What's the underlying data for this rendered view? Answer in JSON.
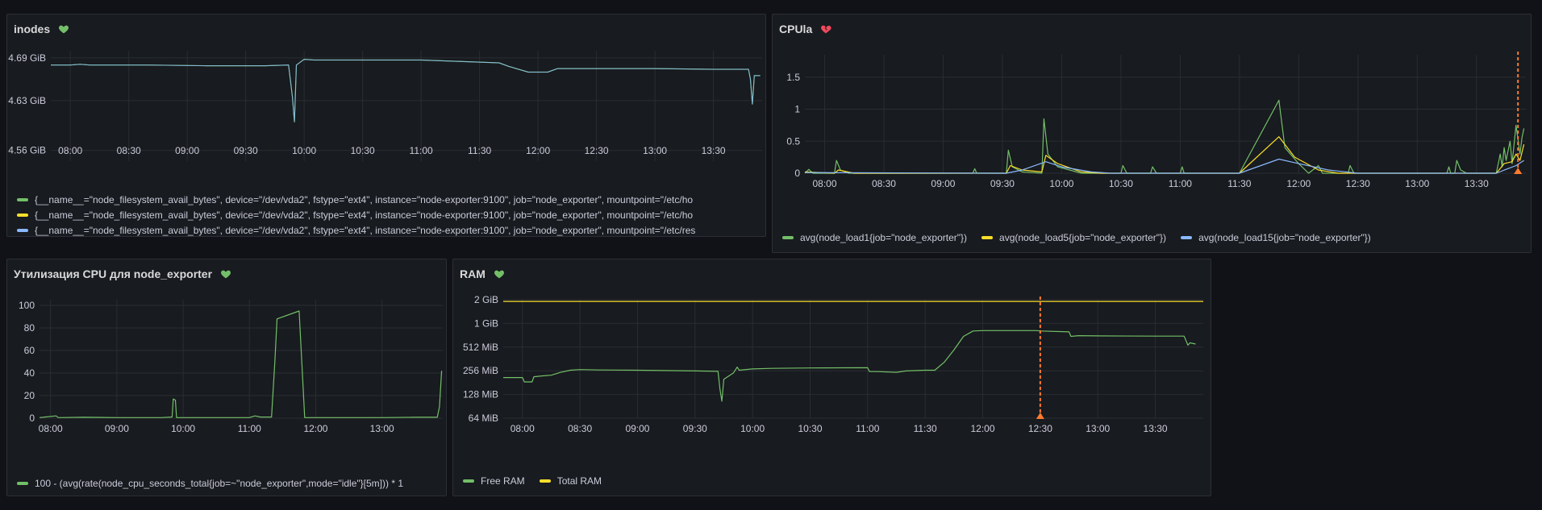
{
  "panels": {
    "inodes": {
      "title": "inodes",
      "heart_color": "#73bf69",
      "legend": [
        {
          "label": "{__name__=\"node_filesystem_avail_bytes\", device=\"/dev/vda2\", fstype=\"ext4\", instance=\"node-exporter:9100\", job=\"node_exporter\", mountpoint=\"/etc/ho",
          "color": "#73bf69"
        },
        {
          "label": "{__name__=\"node_filesystem_avail_bytes\", device=\"/dev/vda2\", fstype=\"ext4\", instance=\"node-exporter:9100\", job=\"node_exporter\", mountpoint=\"/etc/ho",
          "color": "#fade2a"
        },
        {
          "label": "{__name__=\"node_filesystem_avail_bytes\", device=\"/dev/vda2\", fstype=\"ext4\", instance=\"node-exporter:9100\", job=\"node_exporter\", mountpoint=\"/etc/res",
          "color": "#8ab8ff"
        }
      ]
    },
    "cpula": {
      "title": "CPUla",
      "heart_color": "#f2495c",
      "legend": [
        {
          "label": "avg(node_load1{job=\"node_exporter\"})",
          "color": "#73bf69"
        },
        {
          "label": "avg(node_load5{job=\"node_exporter\"})",
          "color": "#fade2a"
        },
        {
          "label": "avg(node_load15{job=\"node_exporter\"})",
          "color": "#8ab8ff"
        }
      ]
    },
    "cpu_util": {
      "title": "Утилизация CPU для node_exporter",
      "heart_color": "#73bf69",
      "legend": [
        {
          "label": "100 - (avg(rate(node_cpu_seconds_total{job=~\"node_exporter\",mode=\"idle\"}[5m])) * 1",
          "color": "#73bf69"
        }
      ]
    },
    "ram": {
      "title": "RAM",
      "heart_color": "#73bf69",
      "legend": [
        {
          "label": "Free RAM",
          "color": "#73bf69"
        },
        {
          "label": "Total RAM",
          "color": "#fade2a"
        }
      ]
    }
  },
  "colors": {
    "grid": "#2a2d33",
    "annotation": "#ff7a2f"
  },
  "chart_data": [
    {
      "id": "inodes",
      "type": "line",
      "title": "inodes",
      "x_ticks": [
        "08:00",
        "08:30",
        "09:00",
        "09:30",
        "10:00",
        "10:30",
        "11:00",
        "11:30",
        "12:00",
        "12:30",
        "13:00",
        "13:30"
      ],
      "y_ticks": [
        "4.69 GiB",
        "4.63 GiB",
        "4.56 GiB"
      ],
      "y_tick_values": [
        4.69,
        4.63,
        4.56
      ],
      "xlim": [
        "07:50",
        "13:55"
      ],
      "ylim": [
        4.545,
        4.7
      ],
      "series": [
        {
          "points": [
            [
              "07:50",
              4.68
            ],
            [
              "08:00",
              4.68
            ],
            [
              "08:05",
              4.681
            ],
            [
              "08:10",
              4.68
            ],
            [
              "08:40",
              4.68
            ],
            [
              "09:10",
              4.679
            ],
            [
              "09:40",
              4.679
            ],
            [
              "09:52",
              4.68
            ],
            [
              "09:54",
              4.635
            ],
            [
              "09:55",
              4.6
            ],
            [
              "09:56",
              4.68
            ],
            [
              "10:00",
              4.688
            ],
            [
              "10:05",
              4.687
            ],
            [
              "10:30",
              4.687
            ],
            [
              "11:00",
              4.687
            ],
            [
              "11:40",
              4.683
            ],
            [
              "11:45",
              4.678
            ],
            [
              "11:55",
              4.67
            ],
            [
              "12:05",
              4.67
            ],
            [
              "12:10",
              4.675
            ],
            [
              "12:30",
              4.675
            ],
            [
              "13:00",
              4.675
            ],
            [
              "13:30",
              4.674
            ],
            [
              "13:48",
              4.674
            ],
            [
              "13:49",
              4.66
            ],
            [
              "13:50",
              4.625
            ],
            [
              "13:51",
              4.665
            ],
            [
              "13:54",
              4.665
            ]
          ]
        }
      ]
    },
    {
      "id": "cpula",
      "type": "line",
      "title": "CPUla",
      "x_ticks": [
        "08:00",
        "08:30",
        "09:00",
        "09:30",
        "10:00",
        "10:30",
        "11:00",
        "11:30",
        "12:00",
        "12:30",
        "13:00",
        "13:30"
      ],
      "y_ticks": [
        "1.5",
        "1",
        "0.5",
        "0"
      ],
      "y_tick_values": [
        1.5,
        1,
        0.5,
        0
      ],
      "xlim": [
        "07:50",
        "13:55"
      ],
      "ylim": [
        0,
        1.85
      ],
      "annotations": [
        {
          "x": "13:51"
        }
      ],
      "series": [
        {
          "color_index": 0,
          "points": [
            [
              "07:50",
              0
            ],
            [
              "07:52",
              0.06
            ],
            [
              "07:54",
              0
            ],
            [
              "08:05",
              0
            ],
            [
              "08:06",
              0.2
            ],
            [
              "08:08",
              0.05
            ],
            [
              "08:12",
              0
            ],
            [
              "09:15",
              0
            ],
            [
              "09:16",
              0.07
            ],
            [
              "09:17",
              0
            ],
            [
              "09:32",
              0
            ],
            [
              "09:33",
              0.36
            ],
            [
              "09:35",
              0.1
            ],
            [
              "09:40",
              0.02
            ],
            [
              "09:50",
              0
            ],
            [
              "09:51",
              0.85
            ],
            [
              "09:53",
              0.3
            ],
            [
              "09:58",
              0.1
            ],
            [
              "10:10",
              0
            ],
            [
              "10:30",
              0
            ],
            [
              "10:31",
              0.12
            ],
            [
              "10:33",
              0
            ],
            [
              "10:45",
              0
            ],
            [
              "10:46",
              0.1
            ],
            [
              "10:48",
              0
            ],
            [
              "11:00",
              0
            ],
            [
              "11:01",
              0.1
            ],
            [
              "11:02",
              0
            ],
            [
              "11:30",
              0
            ],
            [
              "11:50",
              1.14
            ],
            [
              "11:53",
              0.4
            ],
            [
              "12:00",
              0.15
            ],
            [
              "12:05",
              0
            ],
            [
              "12:10",
              0.12
            ],
            [
              "12:12",
              0
            ],
            [
              "12:25",
              0
            ],
            [
              "12:26",
              0.12
            ],
            [
              "12:28",
              0
            ],
            [
              "13:15",
              0
            ],
            [
              "13:16",
              0.1
            ],
            [
              "13:17",
              0
            ],
            [
              "13:19",
              0
            ],
            [
              "13:20",
              0.2
            ],
            [
              "13:22",
              0.05
            ],
            [
              "13:25",
              0
            ],
            [
              "13:40",
              0
            ],
            [
              "13:42",
              0.3
            ],
            [
              "13:43",
              0.1
            ],
            [
              "13:44",
              0.4
            ],
            [
              "13:45",
              0.2
            ],
            [
              "13:47",
              0.5
            ],
            [
              "13:48",
              0.15
            ],
            [
              "13:50",
              0.75
            ],
            [
              "13:52",
              0.3
            ],
            [
              "13:53",
              0.55
            ],
            [
              "13:54",
              0.7
            ]
          ]
        },
        {
          "color_index": 1,
          "points": [
            [
              "07:50",
              0.02
            ],
            [
              "08:05",
              0
            ],
            [
              "08:07",
              0.05
            ],
            [
              "08:15",
              0
            ],
            [
              "09:32",
              0
            ],
            [
              "09:34",
              0.12
            ],
            [
              "09:40",
              0.05
            ],
            [
              "09:50",
              0.02
            ],
            [
              "09:52",
              0.28
            ],
            [
              "09:58",
              0.15
            ],
            [
              "10:10",
              0.02
            ],
            [
              "10:20",
              0
            ],
            [
              "11:30",
              0
            ],
            [
              "11:50",
              0.57
            ],
            [
              "11:58",
              0.25
            ],
            [
              "12:10",
              0.05
            ],
            [
              "12:20",
              0
            ],
            [
              "13:40",
              0
            ],
            [
              "13:44",
              0.15
            ],
            [
              "13:48",
              0.18
            ],
            [
              "13:50",
              0.3
            ],
            [
              "13:52",
              0.2
            ],
            [
              "13:54",
              0.45
            ]
          ]
        },
        {
          "color_index": 2,
          "points": [
            [
              "07:50",
              0.01
            ],
            [
              "09:32",
              0
            ],
            [
              "09:40",
              0.05
            ],
            [
              "09:52",
              0.18
            ],
            [
              "10:00",
              0.1
            ],
            [
              "10:15",
              0.02
            ],
            [
              "10:25",
              0
            ],
            [
              "11:30",
              0
            ],
            [
              "11:50",
              0.22
            ],
            [
              "12:00",
              0.15
            ],
            [
              "12:15",
              0.05
            ],
            [
              "12:30",
              0
            ],
            [
              "13:40",
              0
            ],
            [
              "13:45",
              0.06
            ],
            [
              "13:50",
              0.12
            ],
            [
              "13:54",
              0.2
            ]
          ]
        }
      ]
    },
    {
      "id": "cpu_util",
      "type": "line",
      "title": "Утилизация CPU для node_exporter",
      "x_ticks": [
        "08:00",
        "09:00",
        "10:00",
        "11:00",
        "12:00",
        "13:00"
      ],
      "y_ticks": [
        "100",
        "80",
        "60",
        "40",
        "20",
        "0"
      ],
      "y_tick_values": [
        100,
        80,
        60,
        40,
        20,
        0
      ],
      "xlim": [
        "07:50",
        "13:55"
      ],
      "ylim": [
        0,
        105
      ],
      "series": [
        {
          "points": [
            [
              "07:50",
              0.5
            ],
            [
              "07:55",
              1
            ],
            [
              "08:05",
              2
            ],
            [
              "08:07",
              0.5
            ],
            [
              "08:30",
              0.8
            ],
            [
              "09:00",
              0.5
            ],
            [
              "09:40",
              0.5
            ],
            [
              "09:50",
              1
            ],
            [
              "09:51",
              17
            ],
            [
              "09:53",
              16
            ],
            [
              "09:54",
              0.5
            ],
            [
              "10:30",
              0.5
            ],
            [
              "11:00",
              0.5
            ],
            [
              "11:05",
              2
            ],
            [
              "11:10",
              1
            ],
            [
              "11:20",
              1
            ],
            [
              "11:23",
              50
            ],
            [
              "11:25",
              88
            ],
            [
              "11:45",
              95
            ],
            [
              "11:50",
              0.5
            ],
            [
              "12:30",
              0.5
            ],
            [
              "13:00",
              0.5
            ],
            [
              "13:30",
              0.8
            ],
            [
              "13:50",
              0.8
            ],
            [
              "13:52",
              10
            ],
            [
              "13:54",
              42
            ]
          ]
        }
      ]
    },
    {
      "id": "ram",
      "type": "line",
      "title": "RAM",
      "x_ticks": [
        "08:00",
        "08:30",
        "09:00",
        "09:30",
        "10:00",
        "10:30",
        "11:00",
        "11:30",
        "12:00",
        "12:30",
        "13:00",
        "13:30"
      ],
      "y_ticks": [
        "2 GiB",
        "1 GiB",
        "512 MiB",
        "256 MiB",
        "128 MiB",
        "64 MiB"
      ],
      "y_tick_values_mib": [
        2048,
        1024,
        512,
        256,
        128,
        64
      ],
      "y_scale": "log2",
      "xlim": [
        "07:50",
        "13:55"
      ],
      "ylim_mib": [
        64,
        2048
      ],
      "annotations": [
        {
          "x": "12:30"
        }
      ],
      "series": [
        {
          "name": "Free RAM",
          "points_mib": [
            [
              "07:50",
              210
            ],
            [
              "08:00",
              210
            ],
            [
              "08:01",
              185
            ],
            [
              "08:05",
              185
            ],
            [
              "08:06",
              215
            ],
            [
              "08:10",
              220
            ],
            [
              "08:15",
              225
            ],
            [
              "08:20",
              245
            ],
            [
              "08:25",
              260
            ],
            [
              "08:30",
              265
            ],
            [
              "08:40",
              262
            ],
            [
              "09:00",
              260
            ],
            [
              "09:30",
              255
            ],
            [
              "09:42",
              252
            ],
            [
              "09:43",
              150
            ],
            [
              "09:44",
              105
            ],
            [
              "09:45",
              200
            ],
            [
              "09:50",
              240
            ],
            [
              "09:52",
              285
            ],
            [
              "09:53",
              260
            ],
            [
              "10:00",
              270
            ],
            [
              "10:10",
              275
            ],
            [
              "10:30",
              278
            ],
            [
              "11:00",
              280
            ],
            [
              "11:01",
              250
            ],
            [
              "11:05",
              250
            ],
            [
              "11:15",
              245
            ],
            [
              "11:20",
              255
            ],
            [
              "11:30",
              260
            ],
            [
              "11:35",
              260
            ],
            [
              "11:40",
              330
            ],
            [
              "11:45",
              470
            ],
            [
              "11:50",
              700
            ],
            [
              "11:55",
              820
            ],
            [
              "12:00",
              830
            ],
            [
              "12:20",
              830
            ],
            [
              "12:28",
              830
            ],
            [
              "12:30",
              820
            ],
            [
              "12:45",
              800
            ],
            [
              "12:46",
              700
            ],
            [
              "12:50",
              715
            ],
            [
              "13:00",
              710
            ],
            [
              "13:30",
              705
            ],
            [
              "13:45",
              705
            ],
            [
              "13:47",
              540
            ],
            [
              "13:48",
              580
            ],
            [
              "13:51",
              560
            ]
          ]
        },
        {
          "name": "Total RAM",
          "points_mib": [
            [
              "07:50",
              1950
            ],
            [
              "13:55",
              1950
            ]
          ]
        }
      ]
    }
  ]
}
